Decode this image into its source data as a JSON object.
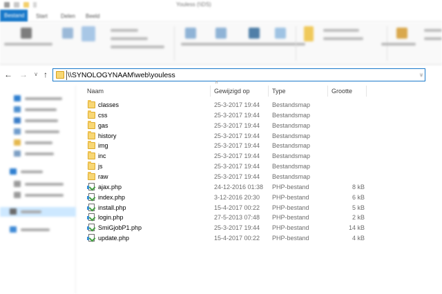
{
  "window": {
    "title": "Youless (\\\\DS)",
    "tabs": [
      "Bestand",
      "Start",
      "Delen",
      "Beeld"
    ]
  },
  "navigation": {
    "back_icon": "arrow-left-icon",
    "forward_icon": "arrow-right-icon",
    "recent_icon": "chevron-down-icon",
    "up_icon": "arrow-up-icon",
    "address": "\\\\SYNOLOGYNAAM\\web\\youless"
  },
  "columns": {
    "name": "Naam",
    "modified": "Gewijzigd op",
    "type": "Type",
    "size": "Grootte"
  },
  "files": [
    {
      "name": "classes",
      "modified": "25-3-2017 19:44",
      "type": "Bestandsmap",
      "size": "",
      "icon": "folder-icon"
    },
    {
      "name": "css",
      "modified": "25-3-2017 19:44",
      "type": "Bestandsmap",
      "size": "",
      "icon": "folder-icon"
    },
    {
      "name": "gas",
      "modified": "25-3-2017 19:44",
      "type": "Bestandsmap",
      "size": "",
      "icon": "folder-icon"
    },
    {
      "name": "history",
      "modified": "25-3-2017 19:44",
      "type": "Bestandsmap",
      "size": "",
      "icon": "folder-icon"
    },
    {
      "name": "img",
      "modified": "25-3-2017 19:44",
      "type": "Bestandsmap",
      "size": "",
      "icon": "folder-icon"
    },
    {
      "name": "inc",
      "modified": "25-3-2017 19:44",
      "type": "Bestandsmap",
      "size": "",
      "icon": "folder-icon"
    },
    {
      "name": "js",
      "modified": "25-3-2017 19:44",
      "type": "Bestandsmap",
      "size": "",
      "icon": "folder-icon"
    },
    {
      "name": "raw",
      "modified": "25-3-2017 19:44",
      "type": "Bestandsmap",
      "size": "",
      "icon": "folder-icon"
    },
    {
      "name": "ajax.php",
      "modified": "24-12-2016 01:38",
      "type": "PHP-bestand",
      "size": "8 kB",
      "icon": "php-file-icon"
    },
    {
      "name": "index.php",
      "modified": "3-12-2016 20:30",
      "type": "PHP-bestand",
      "size": "6 kB",
      "icon": "php-file-icon"
    },
    {
      "name": "install.php",
      "modified": "15-4-2017 00:22",
      "type": "PHP-bestand",
      "size": "5 kB",
      "icon": "php-file-icon"
    },
    {
      "name": "login.php",
      "modified": "27-5-2013 07:48",
      "type": "PHP-bestand",
      "size": "2 kB",
      "icon": "php-file-icon"
    },
    {
      "name": "SmiGjobP1.php",
      "modified": "25-3-2017 19:44",
      "type": "PHP-bestand",
      "size": "14 kB",
      "icon": "php-file-icon"
    },
    {
      "name": "update.php",
      "modified": "15-4-2017 00:22",
      "type": "PHP-bestand",
      "size": "4 kB",
      "icon": "php-file-icon"
    }
  ],
  "colors": {
    "accent": "#1979ca",
    "folder": "#f8d775",
    "selection": "#cde8ff"
  }
}
